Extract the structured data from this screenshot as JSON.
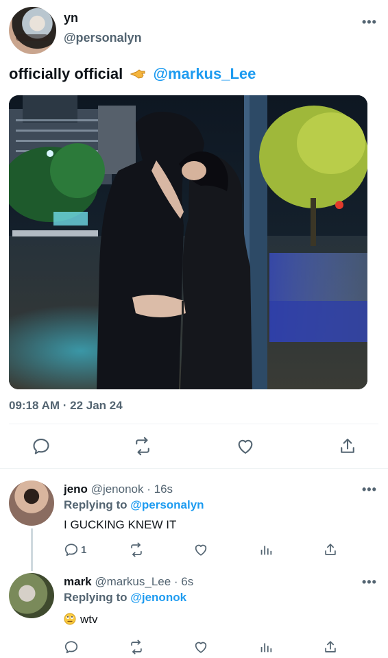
{
  "tweet": {
    "author_name": "yn",
    "author_handle": "@personalyn",
    "text": "officially official",
    "mention": "@markus_Lee",
    "timestamp": "09:18 AM · 22 Jan 24",
    "more": "•••"
  },
  "replies": [
    {
      "name": "jeno",
      "handle": "@jenonok",
      "time": "· 16s",
      "replying_prefix": "Replying to",
      "replying_to": "@personalyn",
      "body": "I GUCKING KNEW IT",
      "reply_count": "1",
      "more": "•••"
    },
    {
      "name": "mark",
      "handle": "@markus_Lee",
      "time": "· 6s",
      "replying_prefix": "Replying to",
      "replying_to": "@jenonok",
      "body": "wtv",
      "more": "•••"
    }
  ],
  "colors": {
    "accent": "#1d9bf0",
    "secondary_text": "#536471",
    "divider": "#eff3f4"
  },
  "icons": [
    "reply-icon",
    "retweet-icon",
    "like-icon",
    "share-icon",
    "views-icon",
    "more-icon"
  ]
}
